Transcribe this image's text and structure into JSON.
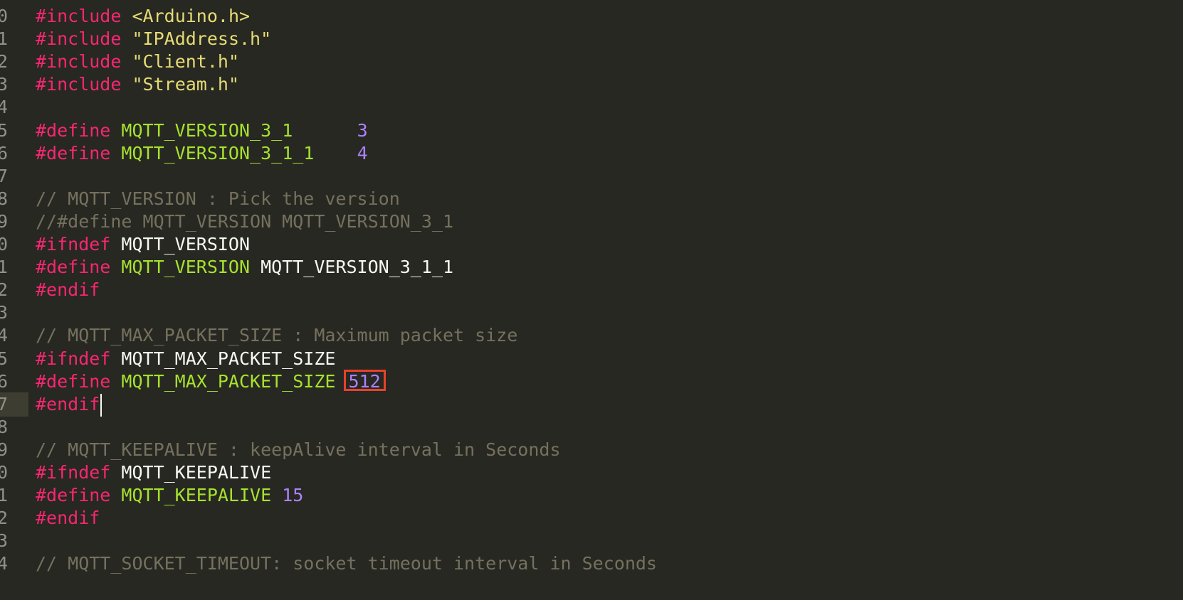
{
  "editor": {
    "theme": {
      "background": "#272822",
      "keyword": "#f92672",
      "string": "#e6db74",
      "name": "#a6e22e",
      "identifier": "#f8f8f2",
      "number": "#ae81ff",
      "comment": "#75715e",
      "highlight_box": "#e8412c"
    },
    "lines": [
      {
        "num": "0",
        "tokens": [
          {
            "t": "kw",
            "v": "#include"
          },
          {
            "t": "id",
            "v": " "
          },
          {
            "t": "str",
            "v": "<Arduino.h>"
          }
        ]
      },
      {
        "num": "1",
        "tokens": [
          {
            "t": "kw",
            "v": "#include"
          },
          {
            "t": "id",
            "v": " "
          },
          {
            "t": "str",
            "v": "\"IPAddress.h\""
          }
        ]
      },
      {
        "num": "2",
        "tokens": [
          {
            "t": "kw",
            "v": "#include"
          },
          {
            "t": "id",
            "v": " "
          },
          {
            "t": "str",
            "v": "\"Client.h\""
          }
        ]
      },
      {
        "num": "3",
        "tokens": [
          {
            "t": "kw",
            "v": "#include"
          },
          {
            "t": "id",
            "v": " "
          },
          {
            "t": "str",
            "v": "\"Stream.h\""
          }
        ]
      },
      {
        "num": "4",
        "tokens": []
      },
      {
        "num": "5",
        "tokens": [
          {
            "t": "kw",
            "v": "#define"
          },
          {
            "t": "id",
            "v": " "
          },
          {
            "t": "name",
            "v": "MQTT_VERSION_3_1"
          },
          {
            "t": "id",
            "v": "      "
          },
          {
            "t": "num",
            "v": "3"
          }
        ]
      },
      {
        "num": "6",
        "tokens": [
          {
            "t": "kw",
            "v": "#define"
          },
          {
            "t": "id",
            "v": " "
          },
          {
            "t": "name",
            "v": "MQTT_VERSION_3_1_1"
          },
          {
            "t": "id",
            "v": "    "
          },
          {
            "t": "num",
            "v": "4"
          }
        ]
      },
      {
        "num": "7",
        "tokens": []
      },
      {
        "num": "8",
        "tokens": [
          {
            "t": "cmt",
            "v": "// MQTT_VERSION : Pick the version"
          }
        ]
      },
      {
        "num": "9",
        "tokens": [
          {
            "t": "cmt",
            "v": "//#define MQTT_VERSION MQTT_VERSION_3_1"
          }
        ]
      },
      {
        "num": "0",
        "tokens": [
          {
            "t": "kw",
            "v": "#ifndef"
          },
          {
            "t": "id",
            "v": " MQTT_VERSION"
          }
        ]
      },
      {
        "num": "1",
        "tokens": [
          {
            "t": "kw",
            "v": "#define"
          },
          {
            "t": "id",
            "v": " "
          },
          {
            "t": "name",
            "v": "MQTT_VERSION"
          },
          {
            "t": "id",
            "v": " MQTT_VERSION_3_1_1"
          }
        ]
      },
      {
        "num": "2",
        "tokens": [
          {
            "t": "kw",
            "v": "#endif"
          }
        ]
      },
      {
        "num": "3",
        "tokens": []
      },
      {
        "num": "4",
        "tokens": [
          {
            "t": "cmt",
            "v": "// MQTT_MAX_PACKET_SIZE : Maximum packet size"
          }
        ]
      },
      {
        "num": "5",
        "tokens": [
          {
            "t": "kw",
            "v": "#ifndef"
          },
          {
            "t": "id",
            "v": " MQTT_MAX_PACKET_SIZE"
          }
        ]
      },
      {
        "num": "6",
        "tokens": [
          {
            "t": "kw",
            "v": "#define"
          },
          {
            "t": "id",
            "v": " "
          },
          {
            "t": "name",
            "v": "MQTT_MAX_PACKET_SIZE"
          },
          {
            "t": "id",
            "v": " "
          },
          {
            "t": "num",
            "v": "512",
            "boxed": true
          }
        ]
      },
      {
        "num": "7",
        "active": true,
        "tokens": [
          {
            "t": "kw",
            "v": "#endif"
          }
        ],
        "caret": true
      },
      {
        "num": "8",
        "tokens": []
      },
      {
        "num": "9",
        "tokens": [
          {
            "t": "cmt",
            "v": "// MQTT_KEEPALIVE : keepAlive interval in Seconds"
          }
        ]
      },
      {
        "num": "0",
        "tokens": [
          {
            "t": "kw",
            "v": "#ifndef"
          },
          {
            "t": "id",
            "v": " MQTT_KEEPALIVE"
          }
        ]
      },
      {
        "num": "1",
        "tokens": [
          {
            "t": "kw",
            "v": "#define"
          },
          {
            "t": "id",
            "v": " "
          },
          {
            "t": "name",
            "v": "MQTT_KEEPALIVE"
          },
          {
            "t": "id",
            "v": " "
          },
          {
            "t": "num",
            "v": "15"
          }
        ]
      },
      {
        "num": "2",
        "tokens": [
          {
            "t": "kw",
            "v": "#endif"
          }
        ]
      },
      {
        "num": "3",
        "tokens": []
      },
      {
        "num": "4",
        "tokens": [
          {
            "t": "cmt",
            "v": "// MQTT_SOCKET_TIMEOUT: socket timeout interval in Seconds"
          }
        ]
      }
    ]
  }
}
